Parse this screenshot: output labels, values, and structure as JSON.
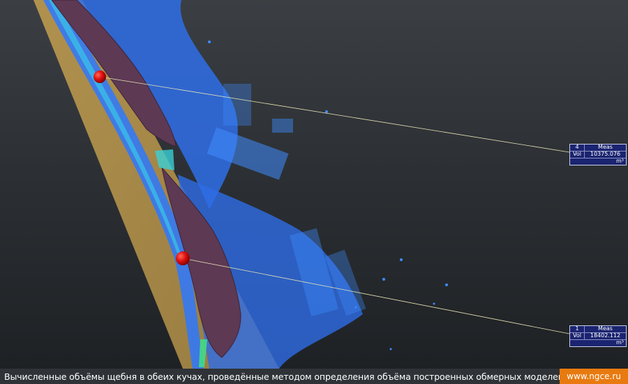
{
  "viewport": {
    "background_top": "#3b3f44",
    "background_bottom": "#1d2023",
    "plane_color": "#a88a4a",
    "stockpile_color": "#5c3a52",
    "point_cloud_color": "#2f7bff",
    "marker_color": "#e01010",
    "leader_line_color": "#e8e3b5"
  },
  "measurements": [
    {
      "id": "4",
      "header": "Meas",
      "label": "Vol",
      "value": "10375.076",
      "unit": "m³"
    },
    {
      "id": "1",
      "header": "Meas",
      "label": "Vol",
      "value": "18402.112",
      "unit": "m³"
    }
  ],
  "caption": {
    "text": "Вычисленные объёмы щебня в обеих кучах, проведённые методом определения объёма построенных обмерных моделей",
    "site": "www.ngce.ru",
    "badge_color": "#e87a10"
  }
}
